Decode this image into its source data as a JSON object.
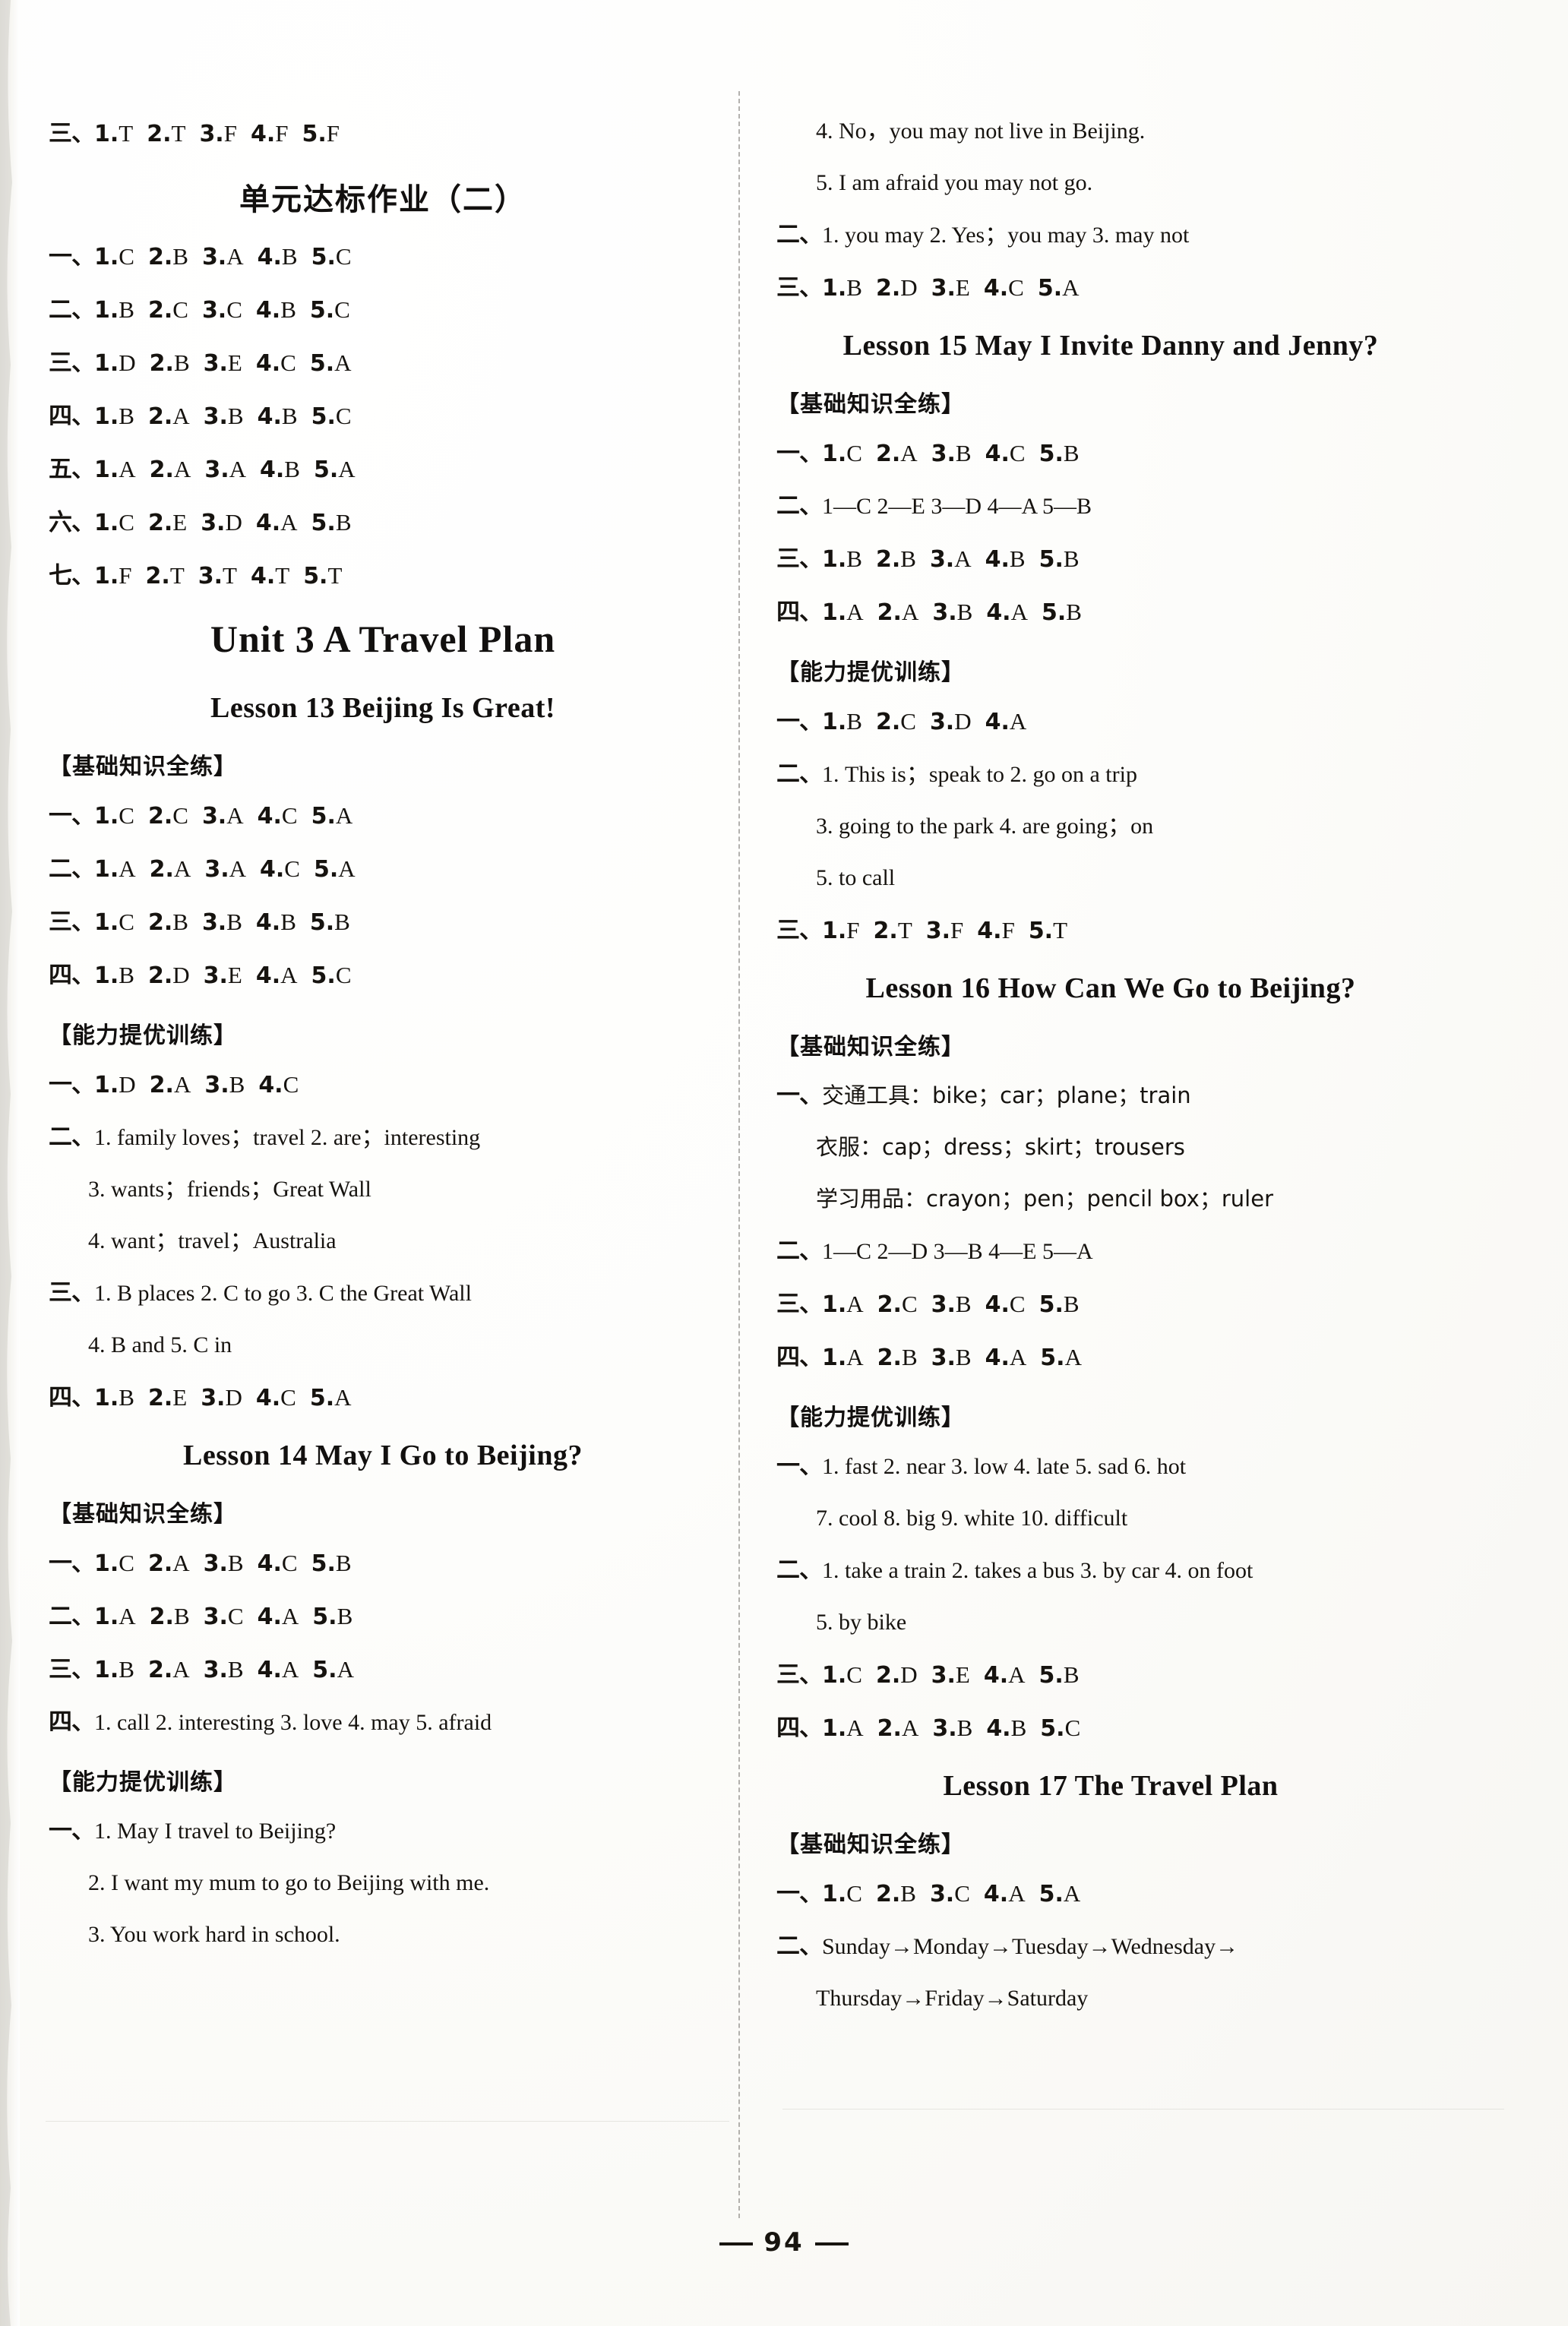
{
  "page": {
    "number": "94",
    "footer_dash": "—"
  },
  "left_column": {
    "top_row": {
      "cn": "三、",
      "items": [
        {
          "n": "1.",
          "v": "T"
        },
        {
          "n": "2.",
          "v": "T"
        },
        {
          "n": "3.",
          "v": "F"
        },
        {
          "n": "4.",
          "v": "F"
        },
        {
          "n": "5.",
          "v": "F"
        }
      ]
    },
    "unit_test_title": "单元达标作业（二）",
    "unit_test_rows": [
      {
        "cn": "一、",
        "items": [
          {
            "n": "1.",
            "v": "C"
          },
          {
            "n": "2.",
            "v": "B"
          },
          {
            "n": "3.",
            "v": "A"
          },
          {
            "n": "4.",
            "v": "B"
          },
          {
            "n": "5.",
            "v": "C"
          }
        ]
      },
      {
        "cn": "二、",
        "items": [
          {
            "n": "1.",
            "v": "B"
          },
          {
            "n": "2.",
            "v": "C"
          },
          {
            "n": "3.",
            "v": "C"
          },
          {
            "n": "4.",
            "v": "B"
          },
          {
            "n": "5.",
            "v": "C"
          }
        ]
      },
      {
        "cn": "三、",
        "items": [
          {
            "n": "1.",
            "v": "D"
          },
          {
            "n": "2.",
            "v": "B"
          },
          {
            "n": "3.",
            "v": "E"
          },
          {
            "n": "4.",
            "v": "C"
          },
          {
            "n": "5.",
            "v": "A"
          }
        ]
      },
      {
        "cn": "四、",
        "items": [
          {
            "n": "1.",
            "v": "B"
          },
          {
            "n": "2.",
            "v": "A"
          },
          {
            "n": "3.",
            "v": "B"
          },
          {
            "n": "4.",
            "v": "B"
          },
          {
            "n": "5.",
            "v": "C"
          }
        ]
      },
      {
        "cn": "五、",
        "items": [
          {
            "n": "1.",
            "v": "A"
          },
          {
            "n": "2.",
            "v": "A"
          },
          {
            "n": "3.",
            "v": "A"
          },
          {
            "n": "4.",
            "v": "B"
          },
          {
            "n": "5.",
            "v": "A"
          }
        ]
      },
      {
        "cn": "六、",
        "items": [
          {
            "n": "1.",
            "v": "C"
          },
          {
            "n": "2.",
            "v": "E"
          },
          {
            "n": "3.",
            "v": "D"
          },
          {
            "n": "4.",
            "v": "A"
          },
          {
            "n": "5.",
            "v": "B"
          }
        ]
      },
      {
        "cn": "七、",
        "items": [
          {
            "n": "1.",
            "v": "F"
          },
          {
            "n": "2.",
            "v": "T"
          },
          {
            "n": "3.",
            "v": "T"
          },
          {
            "n": "4.",
            "v": "T"
          },
          {
            "n": "5.",
            "v": "T"
          }
        ]
      }
    ],
    "unit3_title": "Unit 3   A Travel Plan",
    "lesson13": {
      "title": "Lesson 13   Beijing Is Great!",
      "basic_head": "【基础知识全练】",
      "basic_rows": [
        {
          "cn": "一、",
          "items": [
            {
              "n": "1.",
              "v": "C"
            },
            {
              "n": "2.",
              "v": "C"
            },
            {
              "n": "3.",
              "v": "A"
            },
            {
              "n": "4.",
              "v": "C"
            },
            {
              "n": "5.",
              "v": "A"
            }
          ]
        },
        {
          "cn": "二、",
          "items": [
            {
              "n": "1.",
              "v": "A"
            },
            {
              "n": "2.",
              "v": "A"
            },
            {
              "n": "3.",
              "v": "A"
            },
            {
              "n": "4.",
              "v": "C"
            },
            {
              "n": "5.",
              "v": "A"
            }
          ]
        },
        {
          "cn": "三、",
          "items": [
            {
              "n": "1.",
              "v": "C"
            },
            {
              "n": "2.",
              "v": "B"
            },
            {
              "n": "3.",
              "v": "B"
            },
            {
              "n": "4.",
              "v": "B"
            },
            {
              "n": "5.",
              "v": "B"
            }
          ]
        },
        {
          "cn": "四、",
          "items": [
            {
              "n": "1.",
              "v": "B"
            },
            {
              "n": "2.",
              "v": "D"
            },
            {
              "n": "3.",
              "v": "E"
            },
            {
              "n": "4.",
              "v": "A"
            },
            {
              "n": "5.",
              "v": "C"
            }
          ]
        }
      ],
      "advanced_head": "【能力提优训练】",
      "adv_row1": {
        "cn": "一、",
        "items": [
          {
            "n": "1.",
            "v": "D"
          },
          {
            "n": "2.",
            "v": "A"
          },
          {
            "n": "3.",
            "v": "B"
          },
          {
            "n": "4.",
            "v": "C"
          }
        ]
      },
      "adv_row2_label": "二、",
      "adv_row2_a": "1. family loves；travel   2. are；interesting",
      "adv_row2_b": "3. wants；friends；Great Wall",
      "adv_row2_c": "4. want；travel；Australia",
      "adv_row3_label": "三、",
      "adv_row3_a": "1. B   places   2. C   to go   3. C   the Great Wall",
      "adv_row3_b": "4. B   and   5. C   in",
      "adv_row4": {
        "cn": "四、",
        "items": [
          {
            "n": "1.",
            "v": "B"
          },
          {
            "n": "2.",
            "v": "E"
          },
          {
            "n": "3.",
            "v": "D"
          },
          {
            "n": "4.",
            "v": "C"
          },
          {
            "n": "5.",
            "v": "A"
          }
        ]
      }
    },
    "lesson14": {
      "title": "Lesson 14   May I Go to Beijing?",
      "basic_head": "【基础知识全练】",
      "basic_rows": [
        {
          "cn": "一、",
          "items": [
            {
              "n": "1.",
              "v": "C"
            },
            {
              "n": "2.",
              "v": "A"
            },
            {
              "n": "3.",
              "v": "B"
            },
            {
              "n": "4.",
              "v": "C"
            },
            {
              "n": "5.",
              "v": "B"
            }
          ]
        },
        {
          "cn": "二、",
          "items": [
            {
              "n": "1.",
              "v": "A"
            },
            {
              "n": "2.",
              "v": "B"
            },
            {
              "n": "3.",
              "v": "C"
            },
            {
              "n": "4.",
              "v": "A"
            },
            {
              "n": "5.",
              "v": "B"
            }
          ]
        },
        {
          "cn": "三、",
          "items": [
            {
              "n": "1.",
              "v": "B"
            },
            {
              "n": "2.",
              "v": "A"
            },
            {
              "n": "3.",
              "v": "B"
            },
            {
              "n": "4.",
              "v": "A"
            },
            {
              "n": "5.",
              "v": "A"
            }
          ]
        }
      ],
      "basic_row4_label": "四、",
      "basic_row4": "1. call   2. interesting   3. love   4. may   5. afraid",
      "advanced_head": "【能力提优训练】",
      "adv_label": "一、",
      "adv_1": "1. May I travel to Beijing?",
      "adv_2": "2. I want my mum to go to Beijing with me.",
      "adv_3": "3. You work hard in school."
    }
  },
  "right_column": {
    "lesson14_cont": {
      "adv_4": "4. No，you may not live in Beijing.",
      "adv_5": "5. I am afraid you may not go.",
      "row2_label": "二、",
      "row2": "1. you may    2. Yes；you may    3. may not",
      "row3": {
        "cn": "三、",
        "items": [
          {
            "n": "1.",
            "v": "B"
          },
          {
            "n": "2.",
            "v": "D"
          },
          {
            "n": "3.",
            "v": "E"
          },
          {
            "n": "4.",
            "v": "C"
          },
          {
            "n": "5.",
            "v": "A"
          }
        ]
      }
    },
    "lesson15": {
      "title": "Lesson 15   May I Invite Danny and Jenny?",
      "basic_head": "【基础知识全练】",
      "basic_row1": {
        "cn": "一、",
        "items": [
          {
            "n": "1.",
            "v": "C"
          },
          {
            "n": "2.",
            "v": "A"
          },
          {
            "n": "3.",
            "v": "B"
          },
          {
            "n": "4.",
            "v": "C"
          },
          {
            "n": "5.",
            "v": "B"
          }
        ]
      },
      "basic_row2_label": "二、",
      "basic_row2": "1—C   2—E   3—D   4—A   5—B",
      "basic_row3": {
        "cn": "三、",
        "items": [
          {
            "n": "1.",
            "v": "B"
          },
          {
            "n": "2.",
            "v": "B"
          },
          {
            "n": "3.",
            "v": "A"
          },
          {
            "n": "4.",
            "v": "B"
          },
          {
            "n": "5.",
            "v": "B"
          }
        ]
      },
      "basic_row4": {
        "cn": "四、",
        "items": [
          {
            "n": "1.",
            "v": "A"
          },
          {
            "n": "2.",
            "v": "A"
          },
          {
            "n": "3.",
            "v": "B"
          },
          {
            "n": "4.",
            "v": "A"
          },
          {
            "n": "5.",
            "v": "B"
          }
        ]
      },
      "advanced_head": "【能力提优训练】",
      "adv_row1": {
        "cn": "一、",
        "items": [
          {
            "n": "1.",
            "v": "B"
          },
          {
            "n": "2.",
            "v": "C"
          },
          {
            "n": "3.",
            "v": "D"
          },
          {
            "n": "4.",
            "v": "A"
          }
        ]
      },
      "adv_row2_label": "二、",
      "adv_row2_a": "1. This is；speak to   2. go on a trip",
      "adv_row2_b": "3. going to the park   4. are going；on",
      "adv_row2_c": "5. to call",
      "adv_row3": {
        "cn": "三、",
        "items": [
          {
            "n": "1.",
            "v": "F"
          },
          {
            "n": "2.",
            "v": "T"
          },
          {
            "n": "3.",
            "v": "F"
          },
          {
            "n": "4.",
            "v": "F"
          },
          {
            "n": "5.",
            "v": "T"
          }
        ]
      }
    },
    "lesson16": {
      "title": "Lesson 16   How Can We Go to Beijing?",
      "basic_head": "【基础知识全练】",
      "vocab_label": "一、",
      "vocab_line1": "交通工具：bike；car；plane；train",
      "vocab_line2": "衣服：cap；dress；skirt；trousers",
      "vocab_line3": "学习用品：crayon；pen；pencil box；ruler",
      "row2_label": "二、",
      "row2": "1—C   2—D   3—B   4—E   5—A",
      "row3": {
        "cn": "三、",
        "items": [
          {
            "n": "1.",
            "v": "A"
          },
          {
            "n": "2.",
            "v": "C"
          },
          {
            "n": "3.",
            "v": "B"
          },
          {
            "n": "4.",
            "v": "C"
          },
          {
            "n": "5.",
            "v": "B"
          }
        ]
      },
      "row4": {
        "cn": "四、",
        "items": [
          {
            "n": "1.",
            "v": "A"
          },
          {
            "n": "2.",
            "v": "B"
          },
          {
            "n": "3.",
            "v": "B"
          },
          {
            "n": "4.",
            "v": "A"
          },
          {
            "n": "5.",
            "v": "A"
          }
        ]
      },
      "advanced_head": "【能力提优训练】",
      "adv_row1_label": "一、",
      "adv_row1_a": "1. fast   2. near   3. low   4. late   5. sad   6. hot",
      "adv_row1_b": "7. cool   8. big   9. white   10. difficult",
      "adv_row2_label": "二、",
      "adv_row2_a": "1. take a train   2. takes a bus   3. by car   4. on foot",
      "adv_row2_b": "5. by bike",
      "adv_row3": {
        "cn": "三、",
        "items": [
          {
            "n": "1.",
            "v": "C"
          },
          {
            "n": "2.",
            "v": "D"
          },
          {
            "n": "3.",
            "v": "E"
          },
          {
            "n": "4.",
            "v": "A"
          },
          {
            "n": "5.",
            "v": "B"
          }
        ]
      },
      "adv_row4": {
        "cn": "四、",
        "items": [
          {
            "n": "1.",
            "v": "A"
          },
          {
            "n": "2.",
            "v": "A"
          },
          {
            "n": "3.",
            "v": "B"
          },
          {
            "n": "4.",
            "v": "B"
          },
          {
            "n": "5.",
            "v": "C"
          }
        ]
      }
    },
    "lesson17": {
      "title": "Lesson 17   The Travel Plan",
      "basic_head": "【基础知识全练】",
      "basic_row1": {
        "cn": "一、",
        "items": [
          {
            "n": "1.",
            "v": "C"
          },
          {
            "n": "2.",
            "v": "B"
          },
          {
            "n": "3.",
            "v": "C"
          },
          {
            "n": "4.",
            "v": "A"
          },
          {
            "n": "5.",
            "v": "A"
          }
        ]
      },
      "basic_row2_label": "二、",
      "basic_row2_a": "Sunday→Monday→Tuesday→Wednesday→",
      "basic_row2_b": "Thursday→Friday→Saturday"
    }
  }
}
